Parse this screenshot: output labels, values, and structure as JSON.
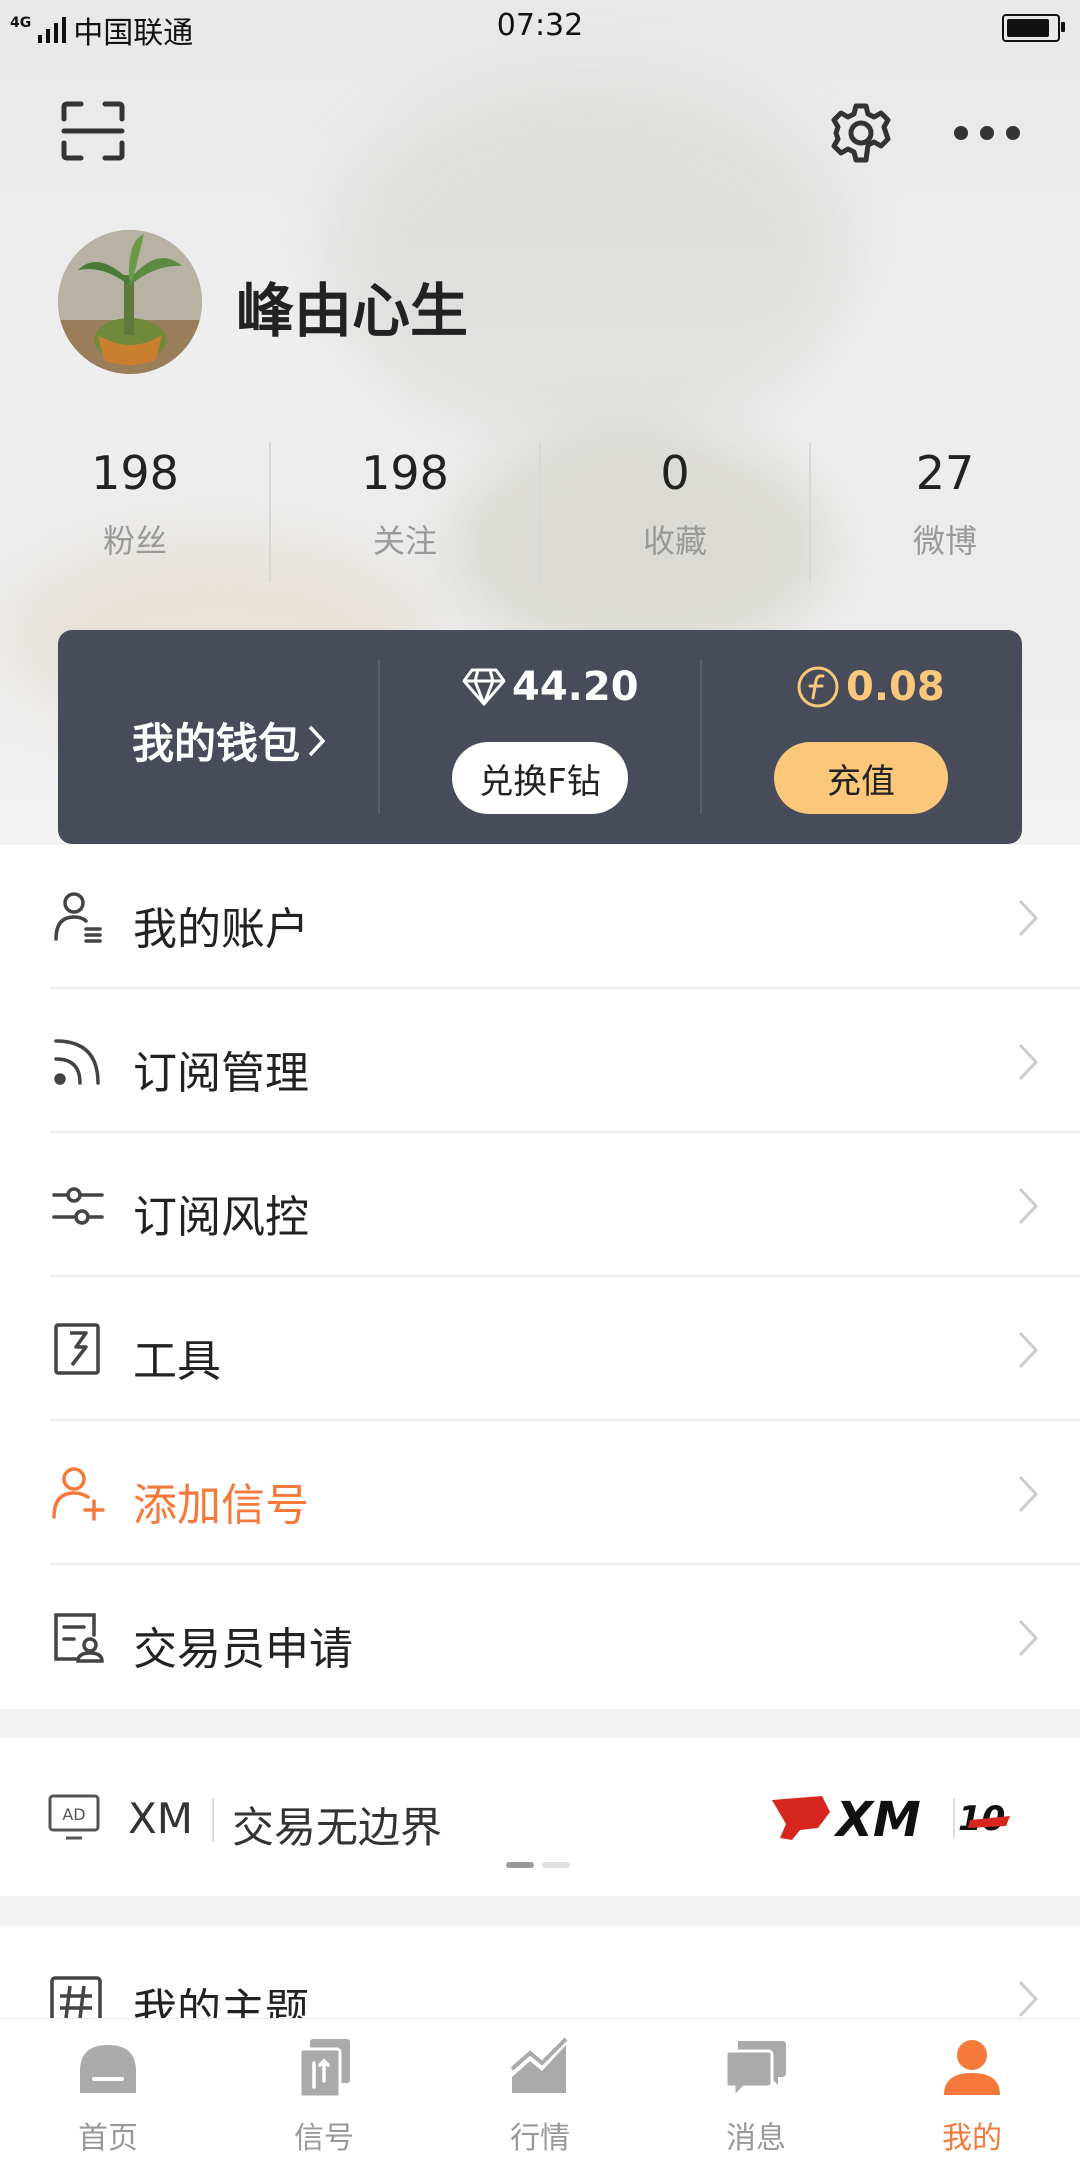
{
  "status_bar": {
    "network": "4G",
    "carrier": "中国联通",
    "time": "07:32"
  },
  "profile": {
    "username": "峰由心生"
  },
  "stats": [
    {
      "value": "198",
      "label": "粉丝"
    },
    {
      "value": "198",
      "label": "关注"
    },
    {
      "value": "0",
      "label": "收藏"
    },
    {
      "value": "27",
      "label": "微博"
    }
  ],
  "wallet": {
    "title": "我的钱包",
    "diamond_value": "44.20",
    "exchange_label": "兑换F钻",
    "coin_value": "0.08",
    "recharge_label": "充值"
  },
  "menu": [
    {
      "label": "我的账户",
      "icon": "account-icon"
    },
    {
      "label": "订阅管理",
      "icon": "rss-icon"
    },
    {
      "label": "订阅风控",
      "icon": "sliders-icon"
    },
    {
      "label": "工具",
      "icon": "tools-icon"
    },
    {
      "label": "添加信号",
      "icon": "add-user-icon"
    },
    {
      "label": "交易员申请",
      "icon": "trader-apply-icon"
    }
  ],
  "ad": {
    "badge": "AD",
    "brand": "XM",
    "slogan": "交易无边界",
    "logo_text": "XM",
    "logo_sub": "10"
  },
  "theme_row": {
    "label": "我的主题"
  },
  "tabs": [
    {
      "label": "首页"
    },
    {
      "label": "信号"
    },
    {
      "label": "行情"
    },
    {
      "label": "消息"
    },
    {
      "label": "我的"
    }
  ],
  "colors": {
    "accent": "#f4793b",
    "wallet_bg": "#474b5a",
    "gold": "#fbc77a"
  }
}
